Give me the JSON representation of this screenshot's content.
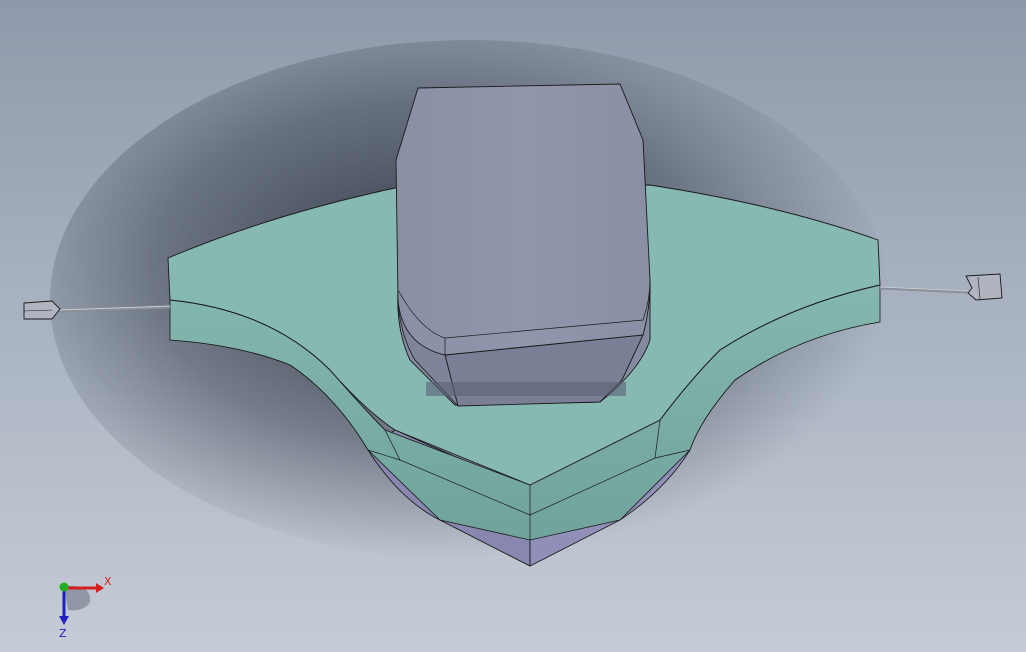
{
  "viewport": {
    "background_top": "#8e9aab",
    "background_bottom": "#c6ccd6",
    "model_colors": {
      "top_face": "#86b9b1",
      "side_face": "#7aaea6",
      "bottom_face": "#8f8fb8",
      "block": "#8b90a6",
      "block_front": "#7b7f96",
      "edges": "#1a1a1a"
    }
  },
  "triad": {
    "x_label": "X",
    "z_label": "Z",
    "x_color": "#d22020",
    "y_color": "#20b020",
    "z_color": "#2020c0"
  }
}
